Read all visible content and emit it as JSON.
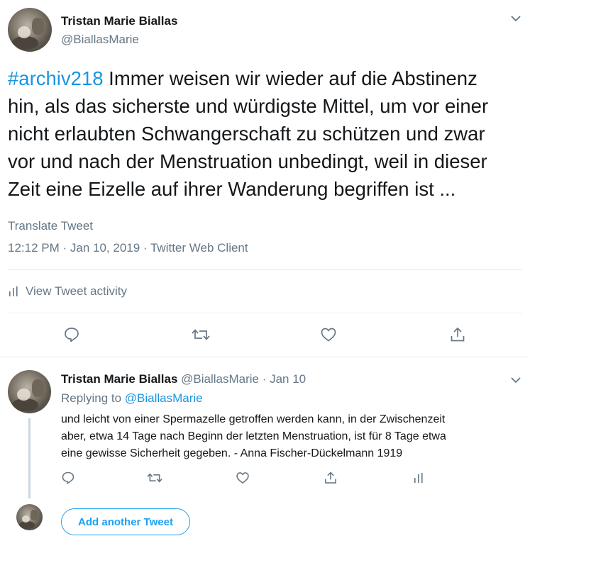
{
  "tweet": {
    "author_name": "Tristan Marie Biallas",
    "author_handle": "@BiallasMarie",
    "hashtag": "#archiv218",
    "text": " Immer weisen wir wieder auf die Abstinenz\nhin, als das sicherste  und würdigste Mittel, um vor einer\nnicht erlaubten Schwangerschaft zu  schützen und zwar\nvor und nach der Menstruation unbedingt, weil in  dieser\nZeit eine Eizelle auf ihrer Wanderung begriffen ist ...",
    "translate_label": "Translate Tweet",
    "timestamp": "12:12 PM · Jan 10, 2019 · Twitter Web Client",
    "activity_label": "View Tweet activity"
  },
  "reply": {
    "author_name": "Tristan Marie Biallas",
    "author_handle_time": "@BiallasMarie · Jan 10",
    "replying_prefix": "Replying to ",
    "replying_to": "@BiallasMarie",
    "text": "und leicht  von einer Spermazelle getroffen werden kann, in der  Zwischenzeit\naber,  etwa 14 Tage nach Beginn der letzten Menstruation,  ist für 8 Tage etwa\neine gewisse Sicherheit gegeben. - Anna Fischer-Dückelmann 1919"
  },
  "composer": {
    "add_button_label": "Add another Tweet"
  },
  "icons": {
    "caret": "chevron-down-icon",
    "reply": "reply-icon",
    "retweet": "retweet-icon",
    "like": "heart-icon",
    "share": "share-icon",
    "activity": "bar-chart-icon"
  },
  "colors": {
    "link": "#1b95e0",
    "muted": "#657786",
    "text": "#14171a",
    "divider": "#e6ecf0",
    "button": "#1da1f2"
  }
}
